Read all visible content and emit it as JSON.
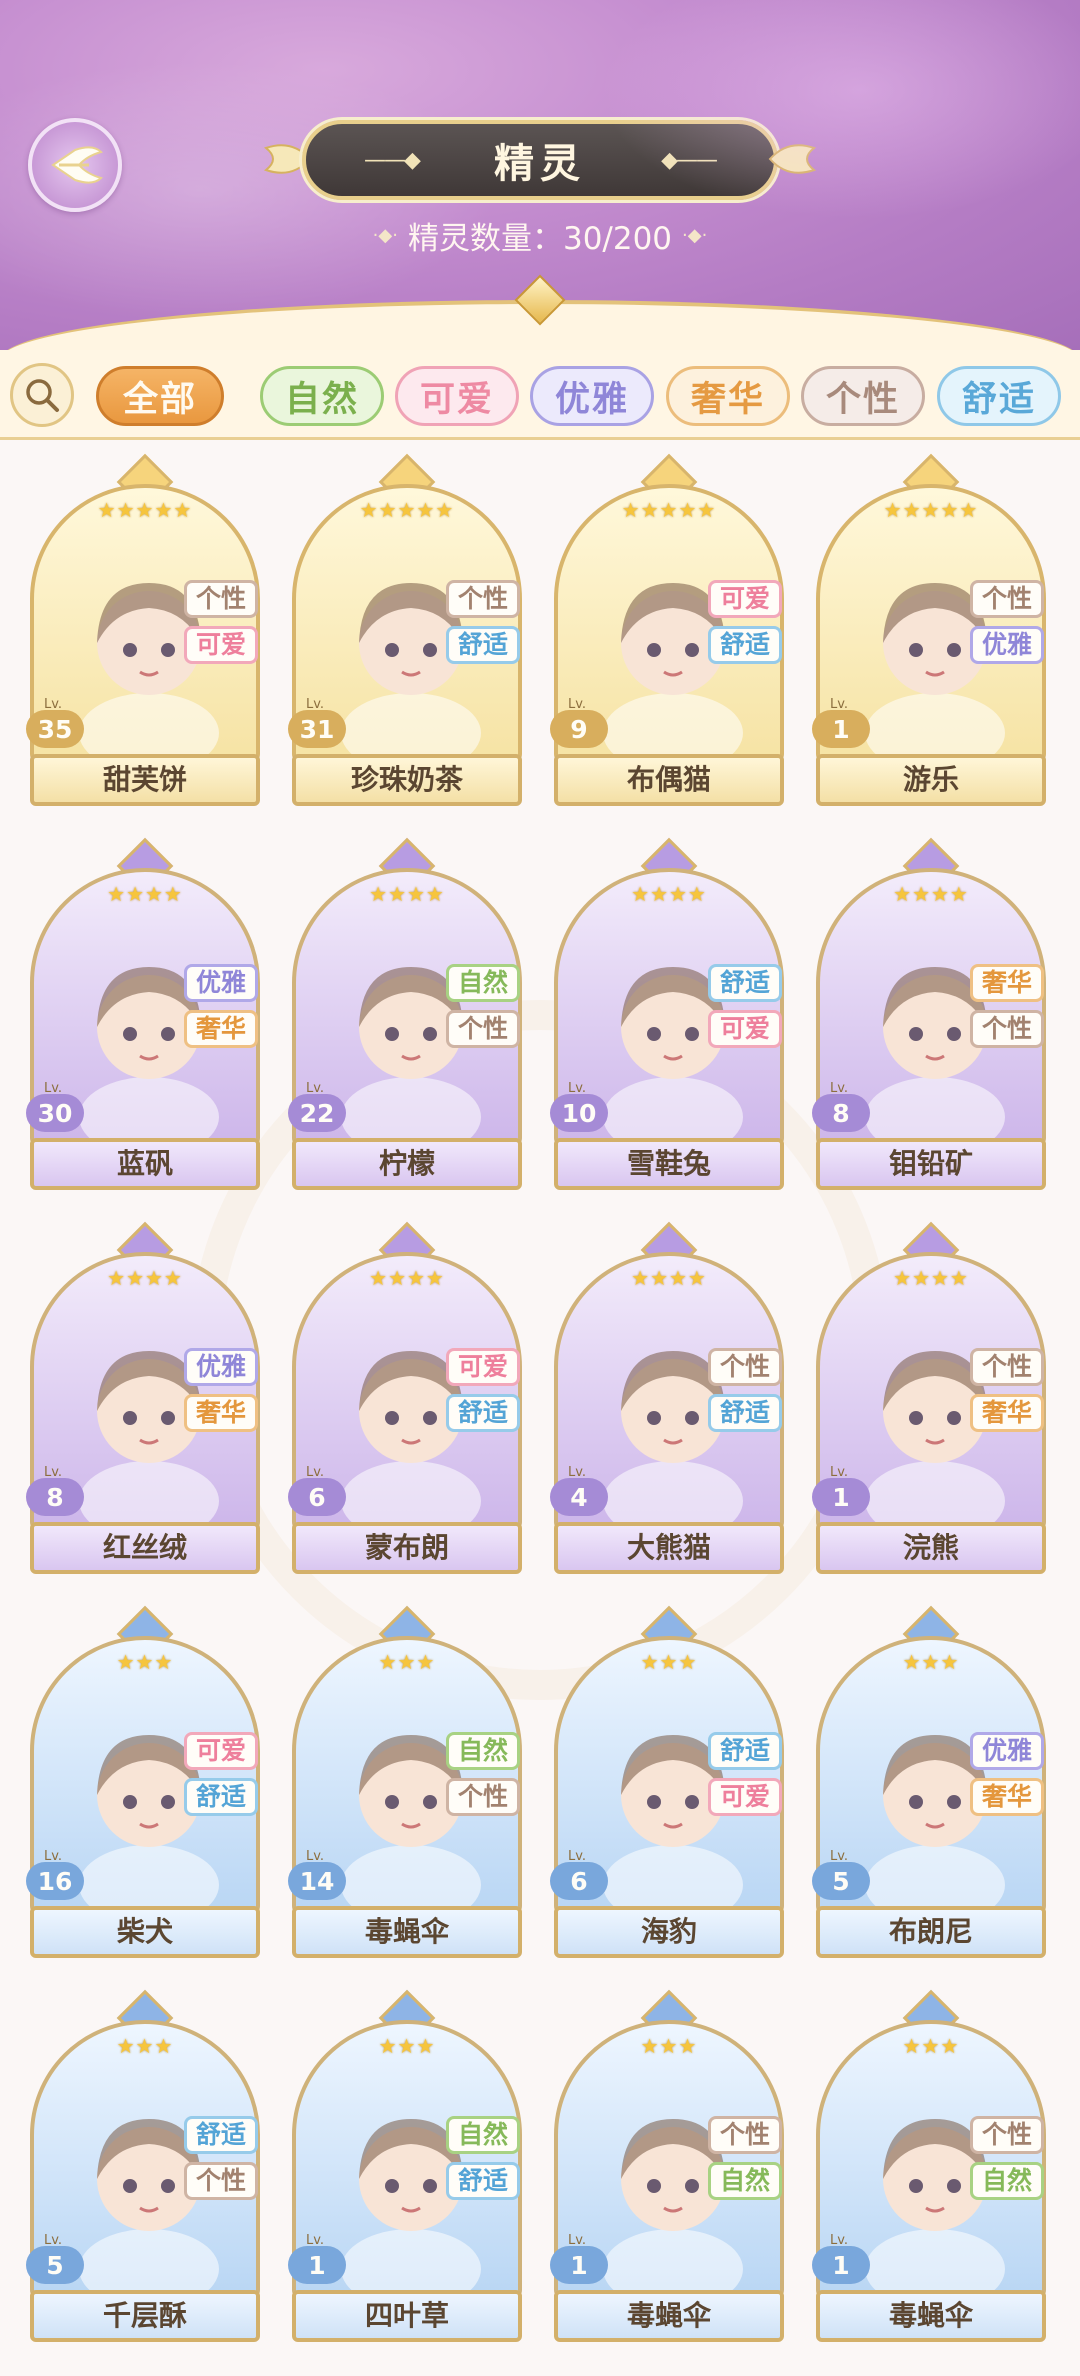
{
  "header": {
    "title": "精灵",
    "count_label": "精灵数量：30/200"
  },
  "filters": [
    {
      "label": "全部",
      "active": true
    },
    {
      "label": "自然",
      "active": false
    },
    {
      "label": "可爱",
      "active": false
    },
    {
      "label": "优雅",
      "active": false
    },
    {
      "label": "奢华",
      "active": false
    },
    {
      "label": "个性",
      "active": false
    },
    {
      "label": "舒适",
      "active": false
    }
  ],
  "spirits": [
    {
      "name": "甜芙饼",
      "level": "35",
      "stars": "★★★★★",
      "tier": "gold",
      "tags": [
        "个性",
        "可爱"
      ]
    },
    {
      "name": "珍珠奶茶",
      "level": "31",
      "stars": "★★★★★",
      "tier": "gold",
      "tags": [
        "个性",
        "舒适"
      ]
    },
    {
      "name": "布偶猫",
      "level": "9",
      "stars": "★★★★★",
      "tier": "gold",
      "tags": [
        "可爱",
        "舒适"
      ]
    },
    {
      "name": "游乐",
      "level": "1",
      "stars": "★★★★★",
      "tier": "gold",
      "tags": [
        "个性",
        "优雅"
      ]
    },
    {
      "name": "蓝矾",
      "level": "30",
      "stars": "★★★★",
      "tier": "purple",
      "tags": [
        "优雅",
        "奢华"
      ]
    },
    {
      "name": "柠檬",
      "level": "22",
      "stars": "★★★★",
      "tier": "purple",
      "tags": [
        "自然",
        "个性"
      ]
    },
    {
      "name": "雪鞋兔",
      "level": "10",
      "stars": "★★★★",
      "tier": "purple",
      "tags": [
        "舒适",
        "可爱"
      ]
    },
    {
      "name": "钼铅矿",
      "level": "8",
      "stars": "★★★★",
      "tier": "purple",
      "tags": [
        "奢华",
        "个性"
      ]
    },
    {
      "name": "红丝绒",
      "level": "8",
      "stars": "★★★★",
      "tier": "purple",
      "tags": [
        "优雅",
        "奢华"
      ]
    },
    {
      "name": "蒙布朗",
      "level": "6",
      "stars": "★★★★",
      "tier": "purple",
      "tags": [
        "可爱",
        "舒适"
      ]
    },
    {
      "name": "大熊猫",
      "level": "4",
      "stars": "★★★★",
      "tier": "purple",
      "tags": [
        "个性",
        "舒适"
      ]
    },
    {
      "name": "浣熊",
      "level": "1",
      "stars": "★★★★",
      "tier": "purple",
      "tags": [
        "个性",
        "奢华"
      ]
    },
    {
      "name": "柴犬",
      "level": "16",
      "stars": "★★★",
      "tier": "blue",
      "tags": [
        "可爱",
        "舒适"
      ]
    },
    {
      "name": "毒蝇伞",
      "level": "14",
      "stars": "★★★",
      "tier": "blue",
      "tags": [
        "自然",
        "个性"
      ]
    },
    {
      "name": "海豹",
      "level": "6",
      "stars": "★★★",
      "tier": "blue",
      "tags": [
        "舒适",
        "可爱"
      ]
    },
    {
      "name": "布朗尼",
      "level": "5",
      "stars": "★★★",
      "tier": "blue",
      "tags": [
        "优雅",
        "奢华"
      ]
    },
    {
      "name": "千层酥",
      "level": "5",
      "stars": "★★★",
      "tier": "blue",
      "tags": [
        "舒适",
        "个性"
      ]
    },
    {
      "name": "四叶草",
      "level": "1",
      "stars": "★★★",
      "tier": "blue",
      "tags": [
        "自然",
        "舒适"
      ]
    },
    {
      "name": "毒蝇伞",
      "level": "1",
      "stars": "★★★",
      "tier": "blue",
      "tags": [
        "个性",
        "自然"
      ]
    },
    {
      "name": "毒蝇伞",
      "level": "1",
      "stars": "★★★",
      "tier": "blue",
      "tags": [
        "个性",
        "自然"
      ]
    }
  ],
  "level_prefix": "Lv.",
  "colors": {
    "header_purple": "#c58ed0",
    "gold_tier": "#f6e3a4",
    "purple_tier": "#cdb6ea",
    "blue_tier": "#b9d6f4",
    "active_filter": "#e9983f"
  },
  "icons": {
    "back": "back-wing-icon",
    "search": "search-icon"
  }
}
